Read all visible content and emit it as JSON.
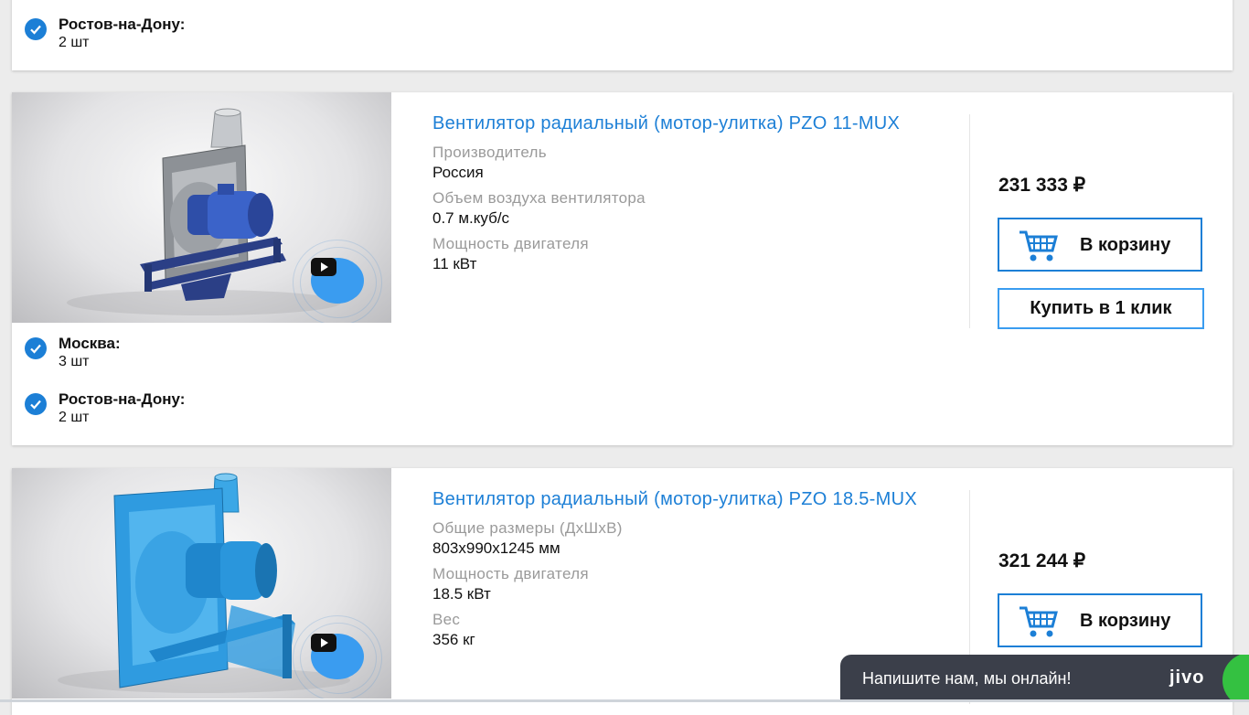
{
  "top_card": {
    "stock": [
      {
        "city": "Ростов-на-Дону:",
        "qty": "2 шт"
      }
    ]
  },
  "products": [
    {
      "title": "Вентилятор радиальный (мотор-улитка) PZO 11-MUX",
      "specs": [
        {
          "label": "Производитель",
          "value": "Россия"
        },
        {
          "label": "Объем воздуха вентилятора",
          "value": "0.7 м.куб/с"
        },
        {
          "label": "Мощность двигателя",
          "value": "11 кВт"
        }
      ],
      "price": "231 333 ₽",
      "cart_label": "В корзину",
      "one_click_label": "Купить в 1 клик",
      "stock": [
        {
          "city": "Москва:",
          "qty": "3 шт"
        },
        {
          "city": "Ростов-на-Дону:",
          "qty": "2 шт"
        }
      ]
    },
    {
      "title": "Вентилятор радиальный (мотор-улитка) PZO 18.5-MUX",
      "specs": [
        {
          "label": "Общие размеры (ДхШхВ)",
          "value": "803x990x1245 мм"
        },
        {
          "label": "Мощность двигателя",
          "value": "18.5 кВт"
        },
        {
          "label": "Вес",
          "value": "356 кг"
        }
      ],
      "price": "321 244 ₽",
      "cart_label": "В корзину"
    }
  ],
  "chat_widget": {
    "text": "Напишите нам, мы онлайн!",
    "logo": "jivo"
  },
  "colors": {
    "accent": "#1c7fd6",
    "play_button": "#3a9cf0",
    "chat_bg": "#3b3f4a",
    "online": "#34c141"
  },
  "icons": [
    "check-circle-icon",
    "play-icon",
    "cart-icon"
  ]
}
